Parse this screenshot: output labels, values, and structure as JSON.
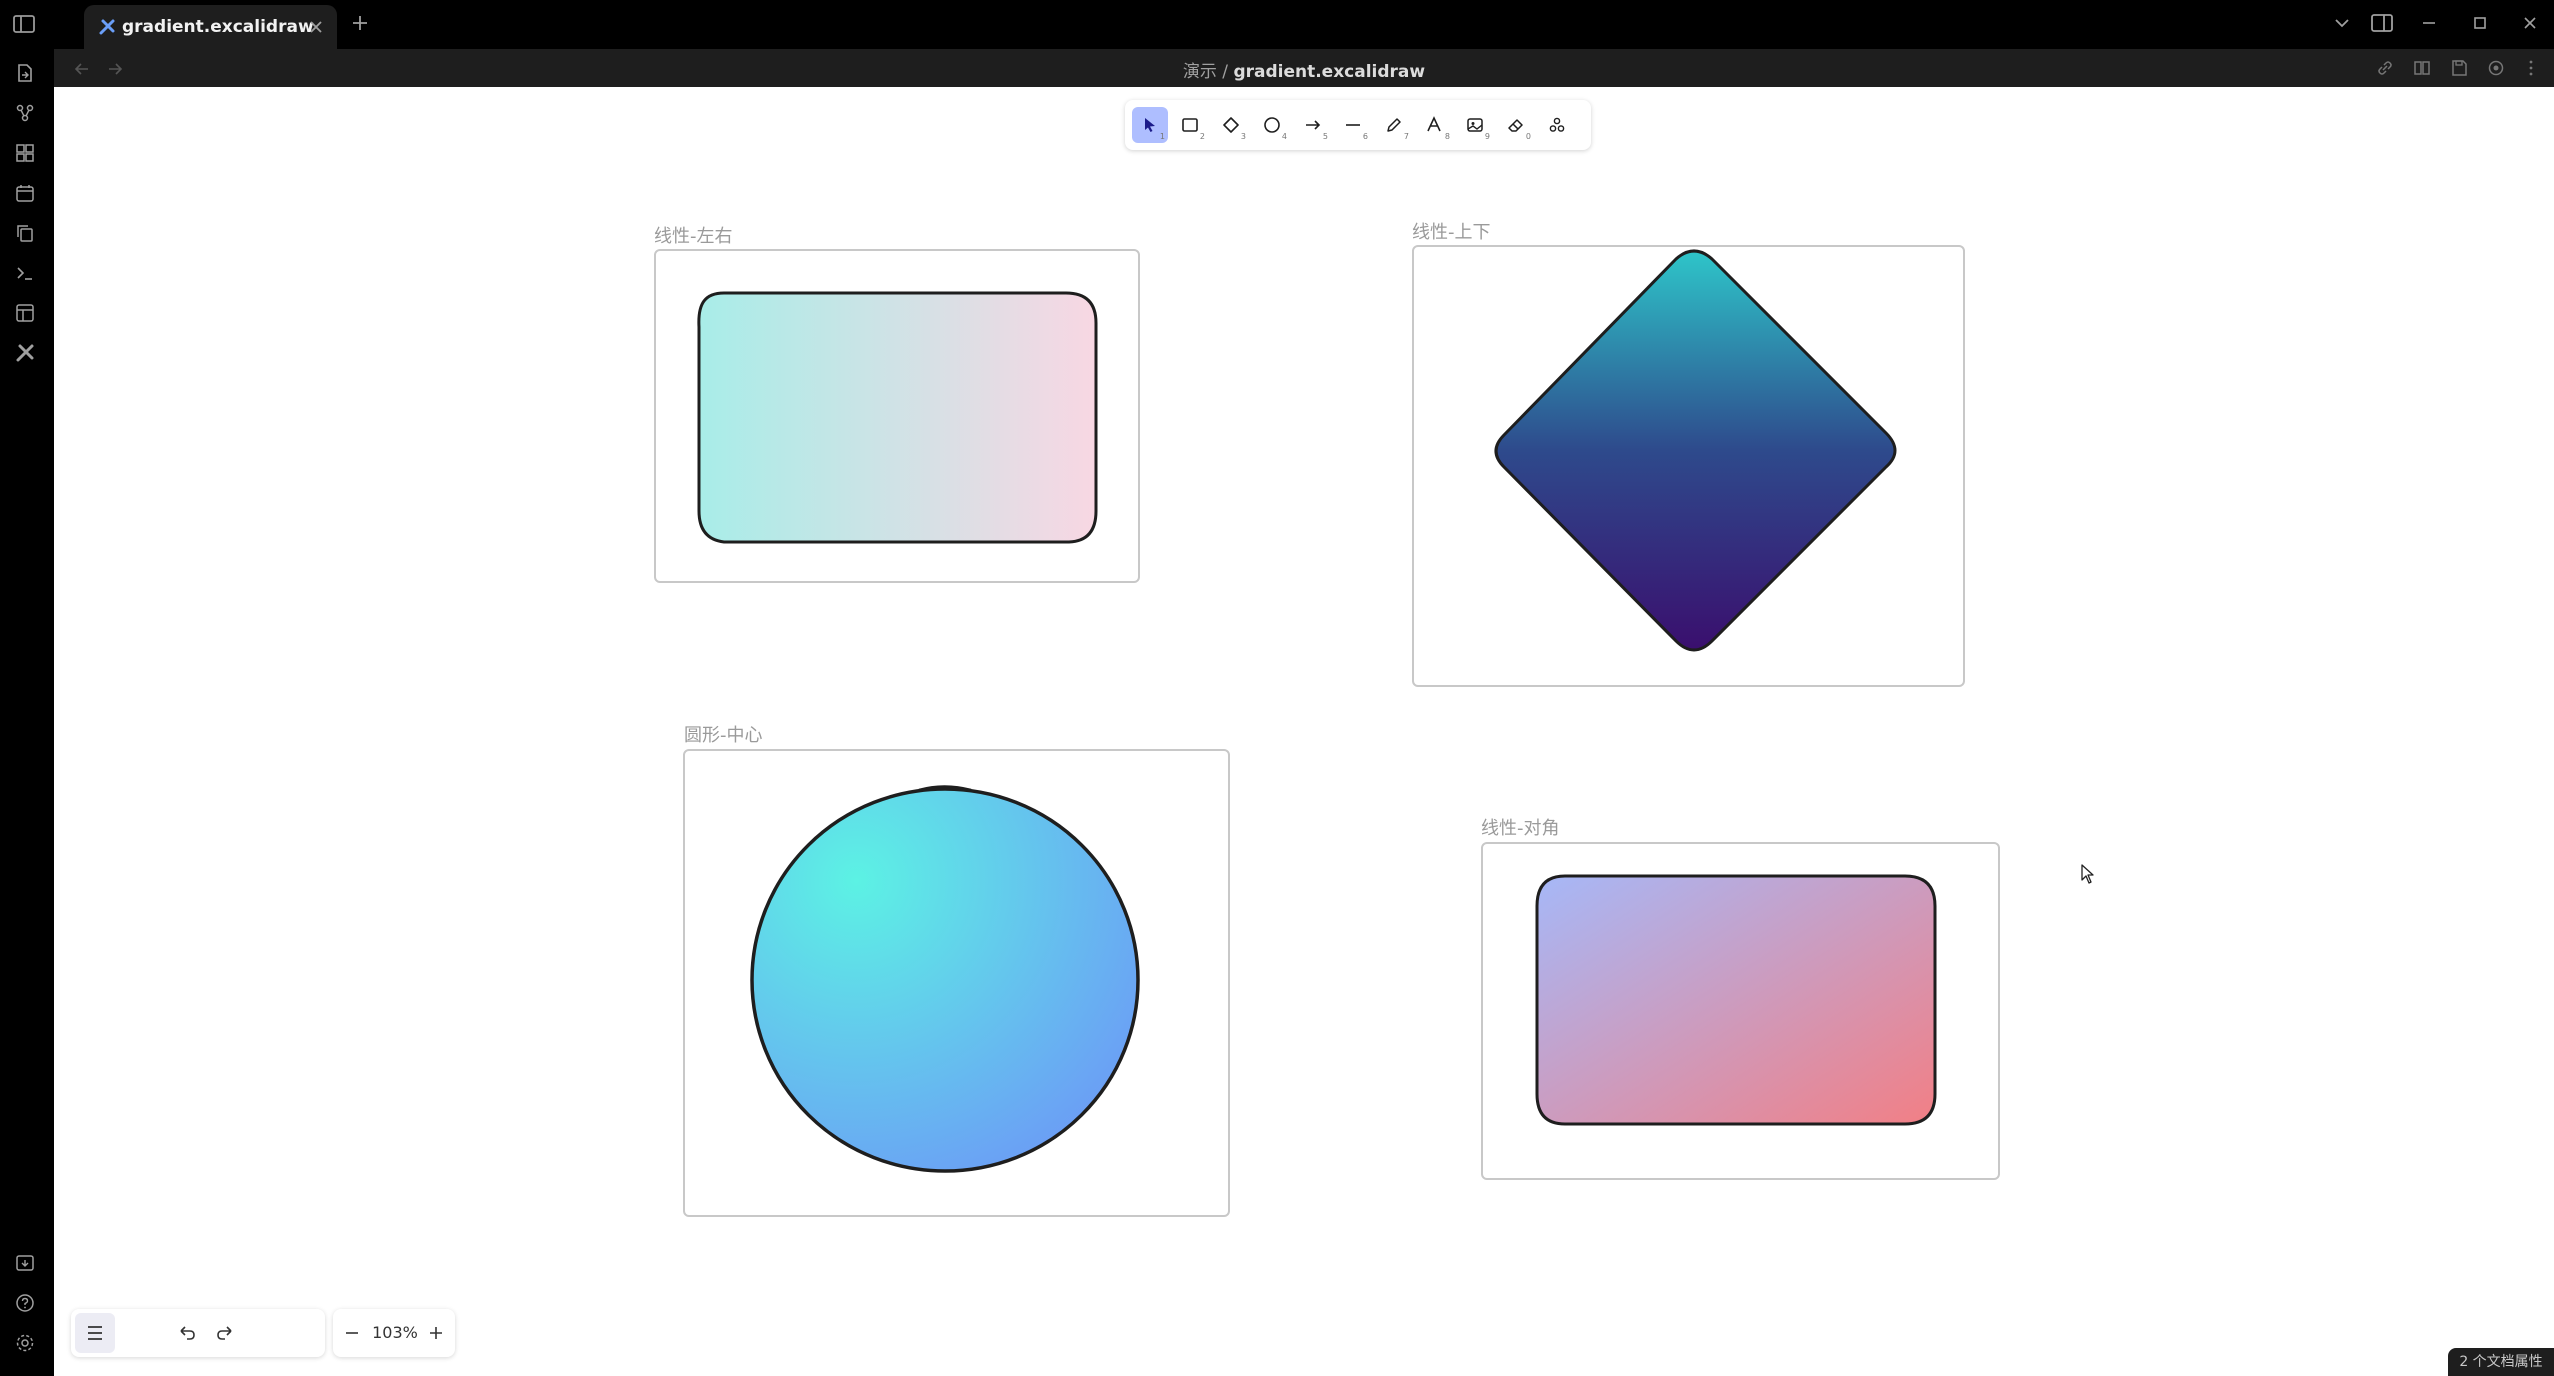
{
  "tab": {
    "title": "gradient.excalidraw"
  },
  "breadcrumb": {
    "folder": "演示",
    "separator": "/",
    "file": "gradient.excalidraw"
  },
  "toolbar": {
    "tools": [
      {
        "name": "selection-tool",
        "key": "1"
      },
      {
        "name": "rectangle-tool",
        "key": "2"
      },
      {
        "name": "diamond-tool",
        "key": "3"
      },
      {
        "name": "ellipse-tool",
        "key": "4"
      },
      {
        "name": "arrow-tool",
        "key": "5"
      },
      {
        "name": "line-tool",
        "key": "6"
      },
      {
        "name": "pencil-tool",
        "key": "7"
      },
      {
        "name": "text-tool",
        "key": "8"
      },
      {
        "name": "image-tool",
        "key": "9"
      },
      {
        "name": "eraser-tool",
        "key": "0"
      },
      {
        "name": "more-tools",
        "key": ""
      }
    ]
  },
  "frames": {
    "linear_lr": {
      "label": "线性-左右"
    },
    "linear_tb": {
      "label": "线性-上下"
    },
    "radial_center": {
      "label": "圆形-中心"
    },
    "linear_diag": {
      "label": "线性-对角"
    }
  },
  "zoom": {
    "level": "103%"
  },
  "status": {
    "text": "2 个文档属性"
  },
  "colors": {
    "accent": "#aebeff",
    "lr_start": "#a8ede8",
    "lr_end": "#f8d7e3",
    "tb_start": "#2ec5c9",
    "tb_mid": "#2e4a8c",
    "tb_end": "#3a0f6e",
    "radial_center": "#5cf2e4",
    "radial_edge": "#6b9ff5",
    "diag_start": "#a6b8f8",
    "diag_end": "#f27f85"
  }
}
